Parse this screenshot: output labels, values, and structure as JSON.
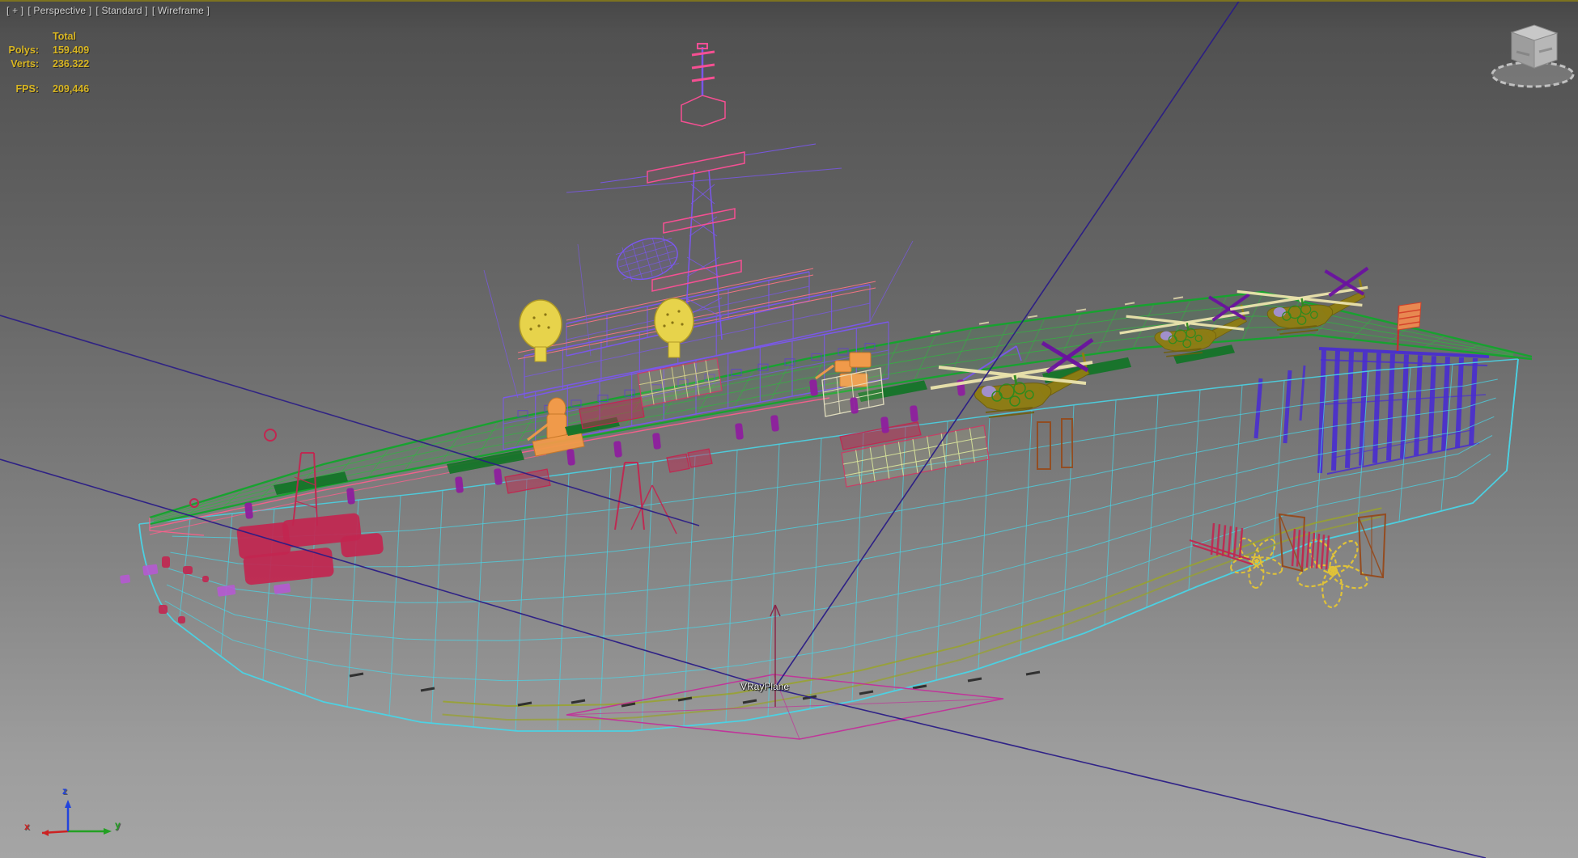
{
  "viewport_label": {
    "general_menu": "[ + ]",
    "point_of_view": "[ Perspective ]",
    "render_preset": "[ Standard ]",
    "shading": "[ Wireframe ]"
  },
  "statistics": {
    "column_header": "Total",
    "rows": [
      {
        "label": "Polys:",
        "value": "159.409"
      },
      {
        "label": "Verts:",
        "value": "236.322"
      },
      {
        "label": "FPS:",
        "value": "209,446"
      }
    ]
  },
  "scene": {
    "object_label": "VRayPlane"
  },
  "axis_gizmo": {
    "x_label": "x",
    "y_label": "y",
    "z_label": "z"
  },
  "icons": {
    "view_cube": "view-cube-navigation",
    "axis_tripod": "world-axis-tripod"
  },
  "colors": {
    "stats_yellow": "#d9b622",
    "viewport_label_gray": "#cfcfcf",
    "active_viewport_border": "#7d731f",
    "hull_cyan": "#49d4e6",
    "deck_green": "#13a52c",
    "island_purple": "#7b57f0",
    "mast_pink": "#ff4f96",
    "rail_pink": "#ff5f8d",
    "radar_dome_yellow": "#e7d34b",
    "gun_orange": "#f09a4a",
    "equipment_crimson": "#c22650",
    "stern_gate_indigo": "#4a2ed0",
    "light_ray_navy": "#2a1c86",
    "vray_gizmo_magenta": "#c2309a",
    "propeller_yellow": "#e0c238",
    "rudder_brown": "#96491a",
    "heli_rotor_cream": "#ece4ad",
    "heli_body_olive": "#8f7d12",
    "heli_tail_purple": "#6b12a0",
    "axis_x_red": "#cc2222",
    "axis_y_green": "#22a022",
    "axis_z_blue": "#2244dd"
  }
}
